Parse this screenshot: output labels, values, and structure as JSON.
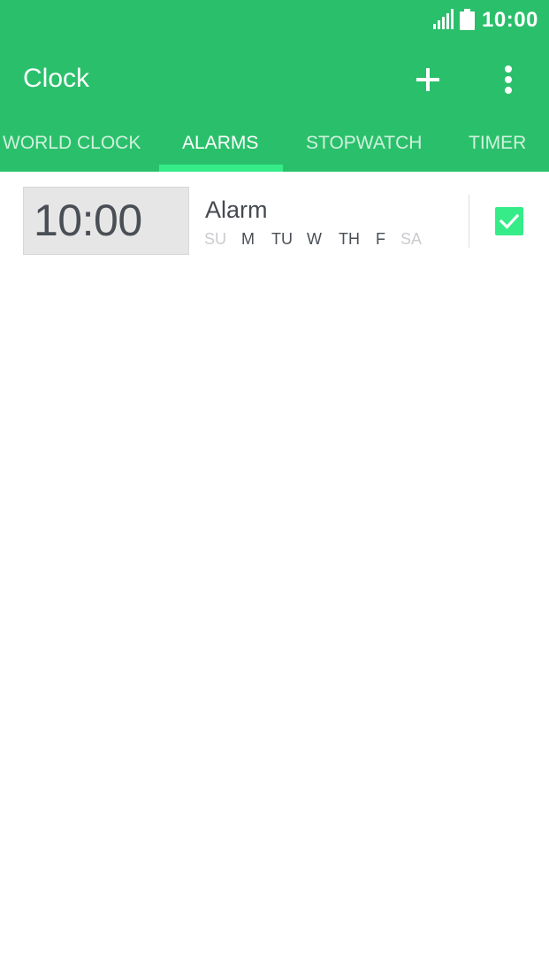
{
  "status_bar": {
    "time": "10:00",
    "signal_icon": "signal-icon",
    "battery_icon": "battery-icon"
  },
  "toolbar": {
    "title": "Clock",
    "add_icon": "plus-icon",
    "menu_icon": "more-vert-icon"
  },
  "tabs": [
    {
      "label": "WORLD CLOCK",
      "active": false
    },
    {
      "label": "ALARMS",
      "active": true
    },
    {
      "label": "STOPWATCH",
      "active": false
    },
    {
      "label": "TIMER",
      "active": false
    }
  ],
  "alarms": [
    {
      "time": "10:00",
      "label": "Alarm",
      "enabled": true,
      "days": [
        {
          "label": "SU",
          "on": false
        },
        {
          "label": "M",
          "on": true
        },
        {
          "label": "TU",
          "on": true
        },
        {
          "label": "W",
          "on": true
        },
        {
          "label": "TH",
          "on": true
        },
        {
          "label": "F",
          "on": true
        },
        {
          "label": "SA",
          "on": false
        }
      ]
    }
  ],
  "colors": {
    "app_bar": "#2ac06b",
    "accent": "#35ec88"
  }
}
